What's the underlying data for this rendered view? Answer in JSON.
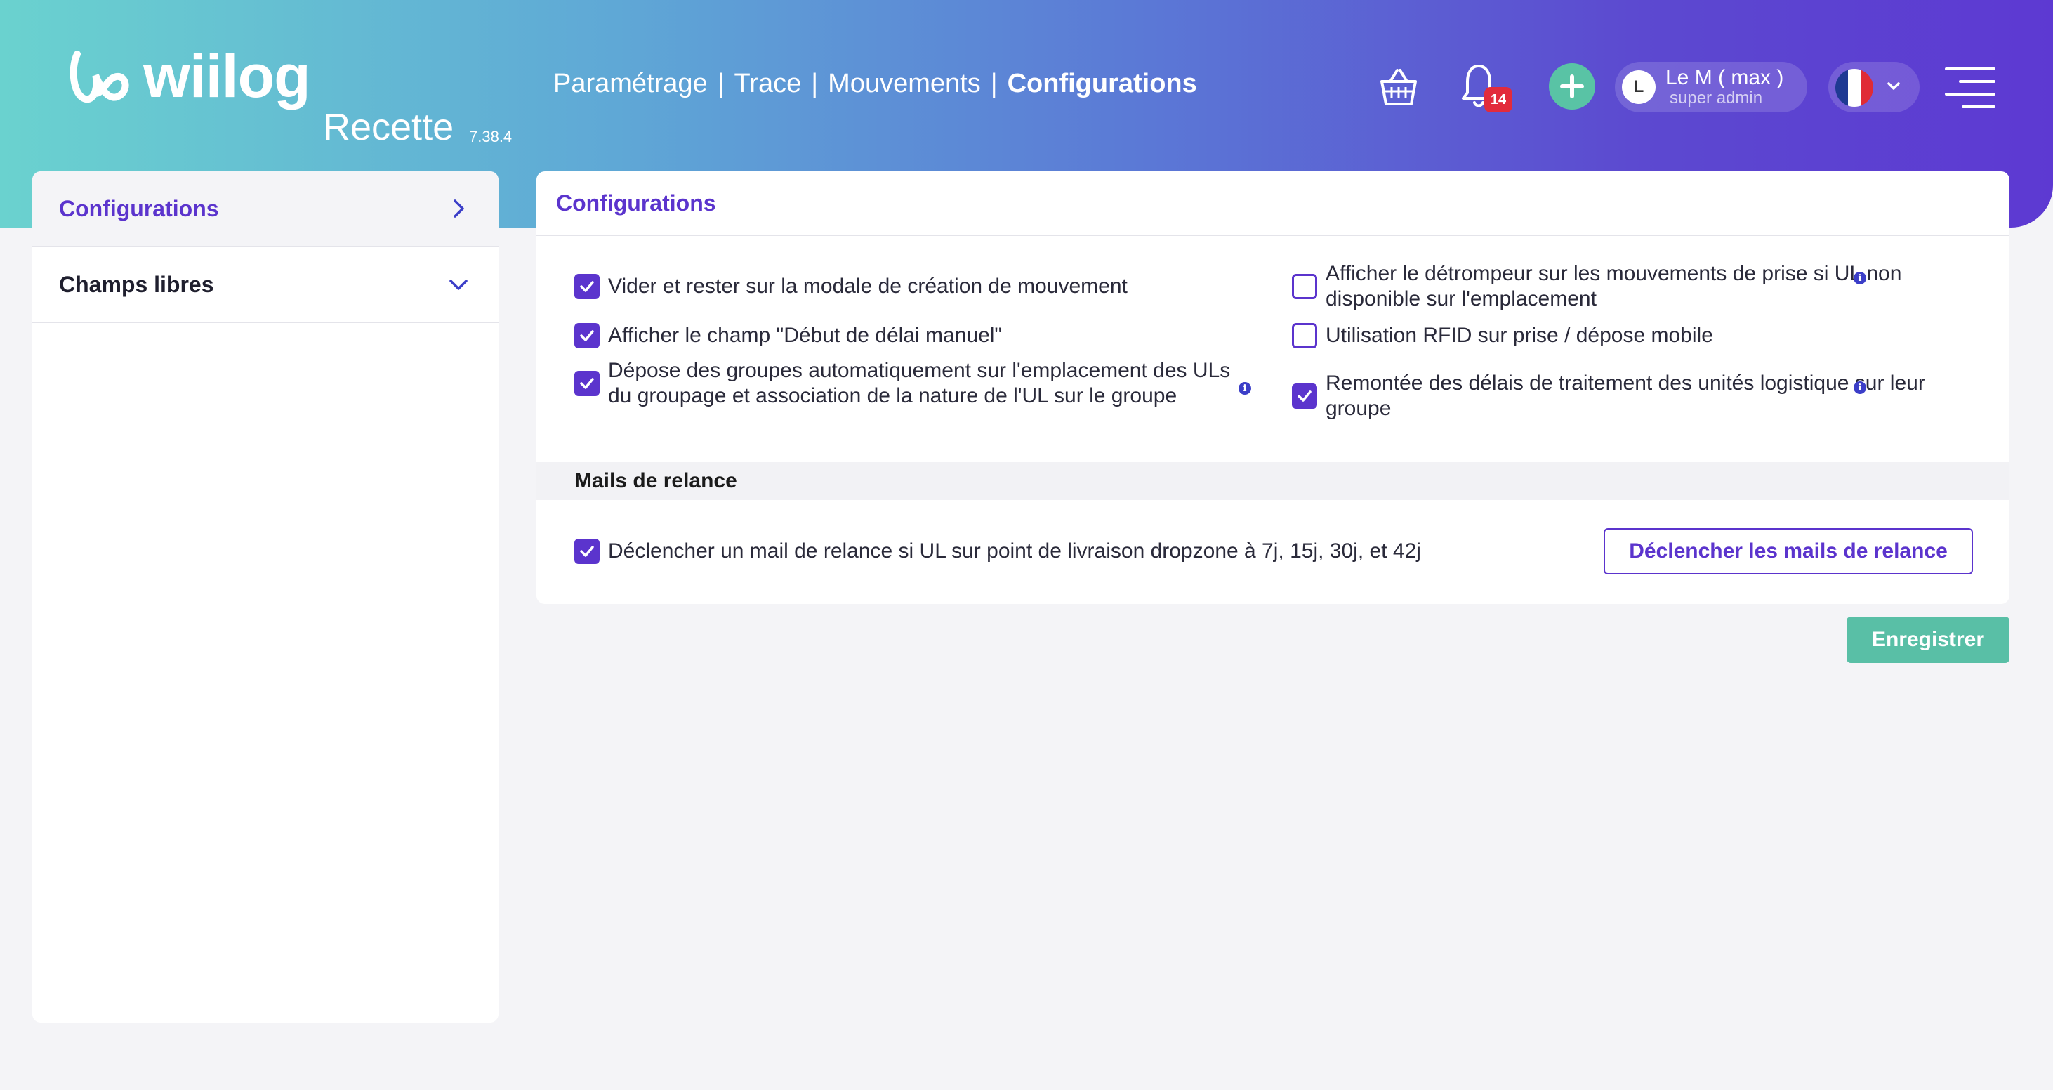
{
  "header": {
    "logo_text": "wiilog",
    "environment": "Recette",
    "version": "7.38.4",
    "nav": [
      {
        "label": "Paramétrage",
        "active": false
      },
      {
        "label": "Trace",
        "active": false
      },
      {
        "label": "Mouvements",
        "active": false
      },
      {
        "label": "Configurations",
        "active": true
      }
    ],
    "nav_separator": "|",
    "notification_count": "14",
    "user": {
      "initial": "L",
      "name": "Le M ( max )",
      "role": "super admin"
    },
    "language": "fr"
  },
  "sidebar": {
    "items": [
      {
        "label": "Configurations",
        "active": true,
        "icon": "chevron-right-icon"
      },
      {
        "label": "Champs libres",
        "active": false,
        "icon": "chevron-down-icon"
      }
    ]
  },
  "panel": {
    "title": "Configurations",
    "options": [
      {
        "label": "Vider et rester sur la modale de création de mouvement",
        "checked": true,
        "info": false
      },
      {
        "label": "Afficher le détrompeur sur les mouvements de prise si UL non disponible sur l'emplacement",
        "checked": false,
        "info": true
      },
      {
        "label": "Afficher le champ \"Début de délai manuel\"",
        "checked": true,
        "info": false
      },
      {
        "label": "Utilisation RFID sur prise / dépose mobile",
        "checked": false,
        "info": false
      },
      {
        "label": "Dépose des groupes automatiquement sur l'emplacement des ULs du groupage et association de la nature de l'UL sur le groupe",
        "checked": true,
        "info": true
      },
      {
        "label": "Remontée des délais de traitement des unités logistique sur leur groupe",
        "checked": true,
        "info": true
      }
    ],
    "section_title": "Mails de relance",
    "relance_option": {
      "label": "Déclencher un mail de relance si UL sur point de livraison dropzone à 7j, 15j, 30j, et 42j",
      "checked": true
    },
    "relance_button": "Déclencher les mails de relance"
  },
  "save_button": "Enregistrer",
  "colors": {
    "accent": "#5b34cd",
    "success": "#59bfa6",
    "badge": "#e22b3c",
    "gradient_start": "#6ad2cf",
    "gradient_end": "#5d39d2"
  }
}
